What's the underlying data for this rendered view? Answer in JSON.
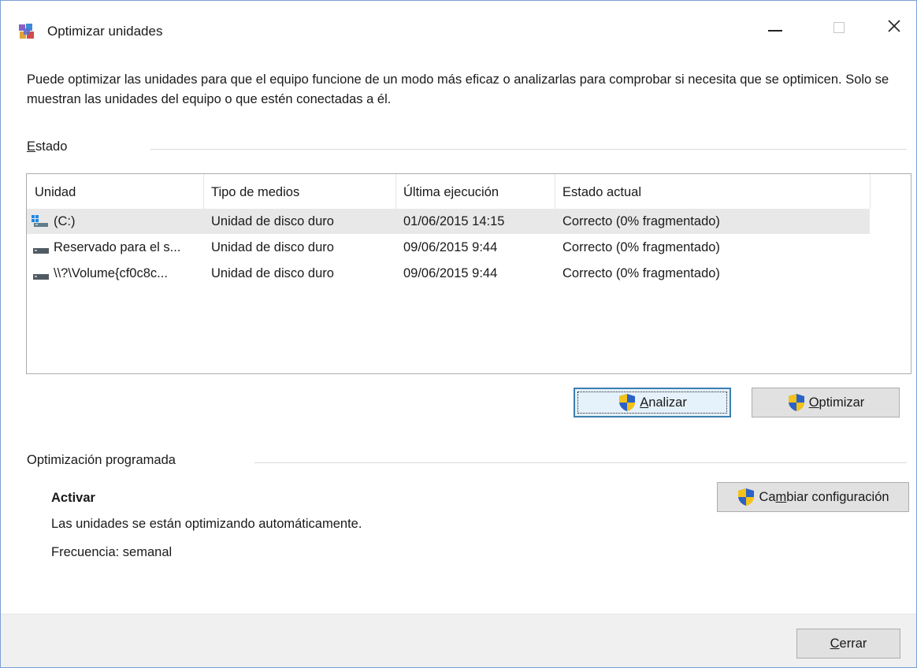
{
  "window": {
    "title": "Optimizar unidades",
    "icon": "defrag-app-icon",
    "controls": {
      "minimize": "minimize-icon",
      "maximize": "maximize-icon",
      "close": "close-icon"
    }
  },
  "description": "Puede optimizar las unidades para que el equipo funcione de un modo más eficaz o analizarlas para comprobar si necesita que se optimicen. Solo se muestran las unidades del equipo o que estén conectadas a él.",
  "status_section": {
    "label_access": "E",
    "label_rest": "stado"
  },
  "drive_list": {
    "columns": [
      "Unidad",
      "Tipo de medios",
      "Última ejecución",
      "Estado actual"
    ],
    "rows": [
      {
        "unit": "(C:)",
        "media": "Unidad de disco duro",
        "last_run": "01/06/2015 14:15",
        "status": "Correcto (0% fragmentado)",
        "icon": "windows-drive-icon",
        "selected": true
      },
      {
        "unit": "Reservado para el s...",
        "media": "Unidad de disco duro",
        "last_run": "09/06/2015 9:44",
        "status": "Correcto (0% fragmentado)",
        "icon": "drive-icon",
        "selected": false
      },
      {
        "unit": "\\\\?\\Volume{cf0c8c...",
        "media": "Unidad de disco duro",
        "last_run": "09/06/2015 9:44",
        "status": "Correcto (0% fragmentado)",
        "icon": "drive-icon",
        "selected": false
      }
    ]
  },
  "actions": {
    "analyze_access": "A",
    "analyze_rest": "nalizar",
    "optimize_access": "O",
    "optimize_rest": "ptimizar"
  },
  "scheduled": {
    "label": "Optimización programada",
    "state": "Activar",
    "info": "Las unidades se están optimizando automáticamente.",
    "frequency": "Frecuencia: semanal",
    "change_pre": "Ca",
    "change_access": "m",
    "change_rest": "biar configuración"
  },
  "footer": {
    "close_access": "C",
    "close_rest": "errar"
  },
  "colors": {
    "shield_blue": "#2b62c6",
    "shield_yellow": "#f4c21a",
    "focus_border": "#3c7fb1",
    "selected_row": "#e8e8e8"
  }
}
